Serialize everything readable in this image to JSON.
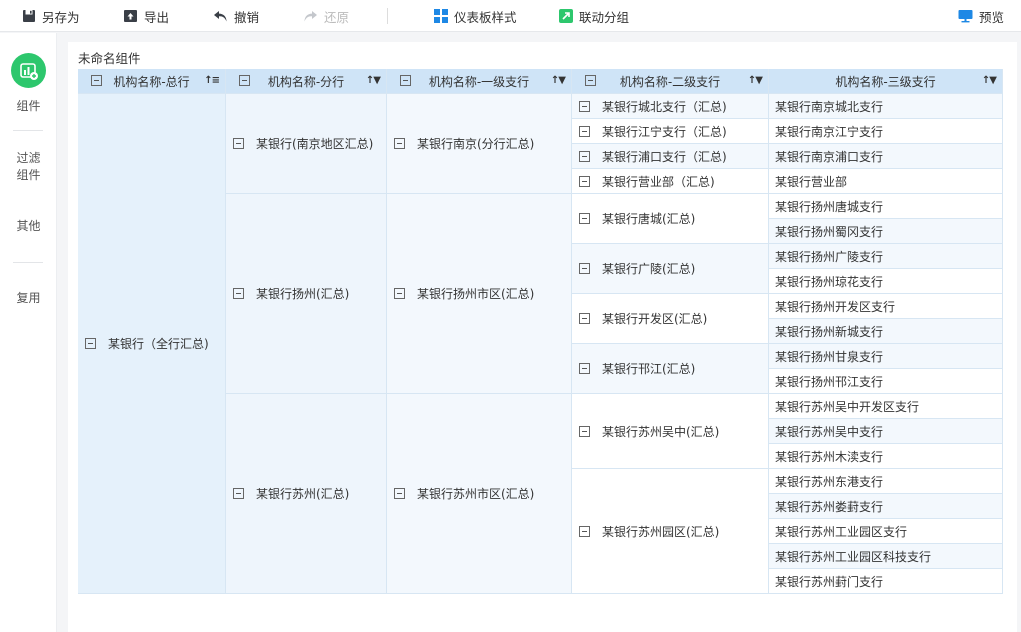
{
  "toolbar": {
    "save_as": "另存为",
    "export": "导出",
    "undo": "撤销",
    "redo": "还原",
    "dashboard_style": "仪表板样式",
    "linkage_group": "联动分组",
    "preview": "预览"
  },
  "sidebar": {
    "components": "组件",
    "filter_line1": "过滤",
    "filter_line2": "组件",
    "other": "其他",
    "reuse": "复用"
  },
  "widget": {
    "title": "未命名组件"
  },
  "table": {
    "headers": [
      "机构名称-总行",
      "机构名称-分行",
      "机构名称-一级支行",
      "机构名称-二级支行",
      "机构名称-三级支行"
    ],
    "sort_icons": [
      "↑≡",
      "↑▼",
      "↑▼",
      "↑▼",
      "↑▼"
    ],
    "l0": "某银行（全行汇总)",
    "l1": [
      "某银行(南京地区汇总)",
      "某银行扬州(汇总)",
      "某银行苏州(汇总)"
    ],
    "l2": [
      "某银行南京(分行汇总)",
      "某银行扬州市区(汇总)",
      "某银行苏州市区(汇总)"
    ],
    "l3": [
      "某银行城北支行（汇总)",
      "某银行江宁支行（汇总)",
      "某银行浦口支行（汇总)",
      "某银行营业部（汇总)",
      "某银行唐城(汇总)",
      "某银行广陵(汇总)",
      "某银行开发区(汇总)",
      "某银行邗江(汇总)",
      "某银行苏州吴中(汇总)",
      "某银行苏州园区(汇总)"
    ],
    "l4": [
      "某银行南京城北支行",
      "某银行南京江宁支行",
      "某银行南京浦口支行",
      "某银行营业部",
      "某银行扬州唐城支行",
      "某银行扬州蜀冈支行",
      "某银行扬州广陵支行",
      "某银行扬州琼花支行",
      "某银行扬州开发区支行",
      "某银行扬州新城支行",
      "某银行扬州甘泉支行",
      "某银行扬州邗江支行",
      "某银行苏州吴中开发区支行",
      "某银行苏州吴中支行",
      "某银行苏州木渎支行",
      "某银行苏州东港支行",
      "某银行苏州娄葑支行",
      "某银行苏州工业园区支行",
      "某银行苏州工业园区科技支行",
      "某银行苏州葑门支行"
    ]
  },
  "colors": {
    "accent": "#2dc76d",
    "header_bg": "#cfe4f7",
    "icon_blue": "#1e88e5"
  }
}
